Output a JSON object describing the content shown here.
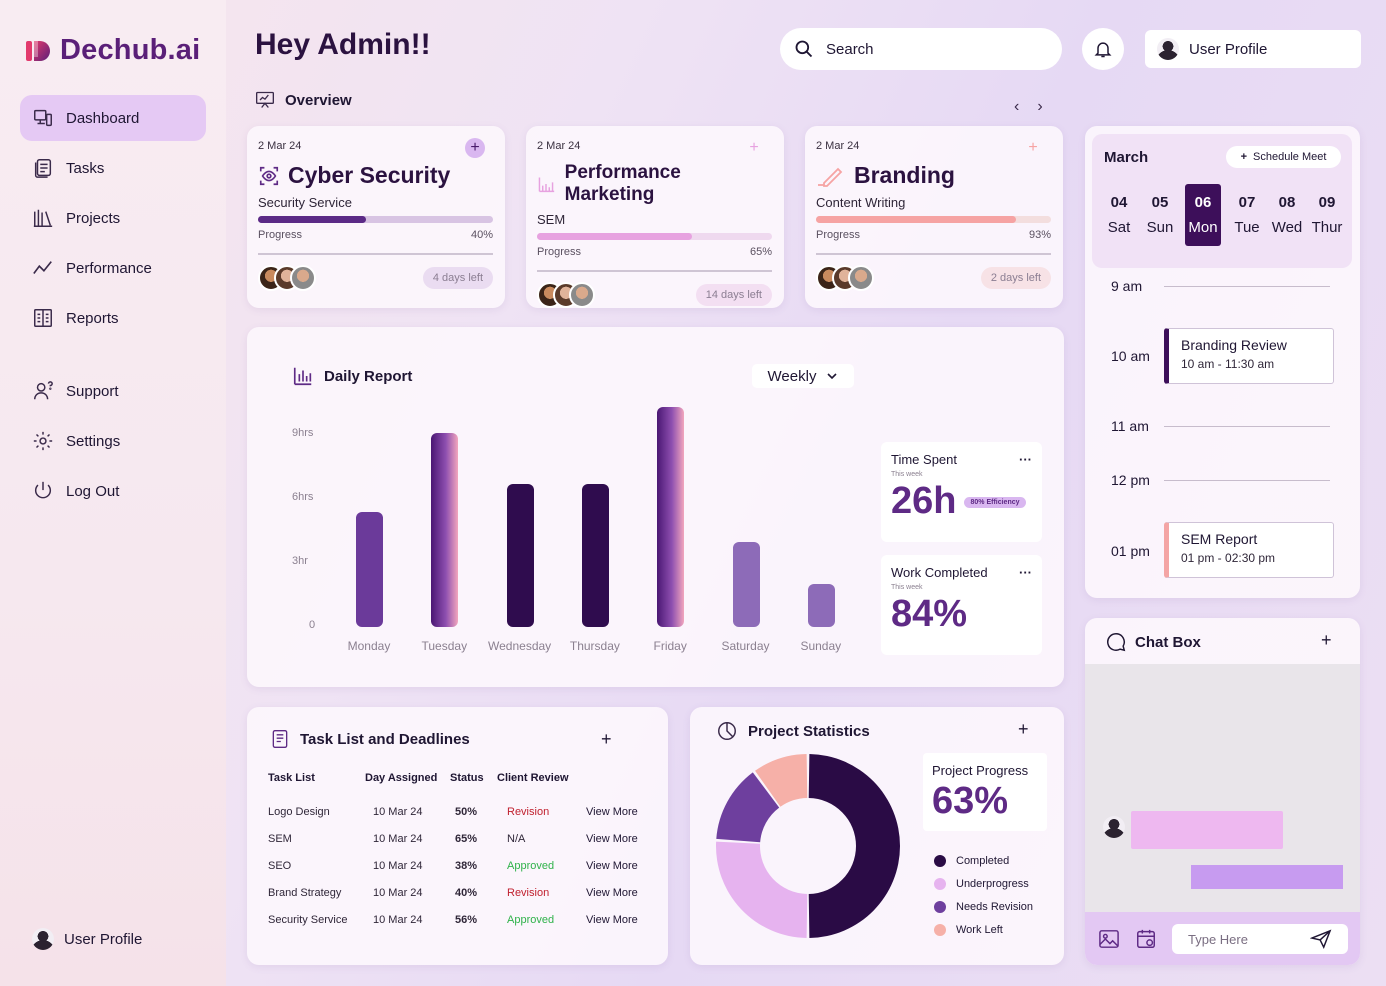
{
  "brand": {
    "name": "Dechub.ai"
  },
  "sidebar": {
    "items": [
      {
        "label": "Dashboard",
        "icon": "dashboard-icon",
        "active": true
      },
      {
        "label": "Tasks",
        "icon": "tasks-icon"
      },
      {
        "label": "Projects",
        "icon": "projects-icon"
      },
      {
        "label": "Performance",
        "icon": "performance-icon"
      },
      {
        "label": "Reports",
        "icon": "reports-icon"
      },
      {
        "label": "Support",
        "icon": "support-icon"
      },
      {
        "label": "Settings",
        "icon": "gear-icon"
      },
      {
        "label": "Log Out",
        "icon": "power-icon"
      }
    ],
    "profile_label": "User Profile"
  },
  "header": {
    "greeting": "Hey Admin!!",
    "search_label": "Search",
    "profile_label": "User Profile"
  },
  "overview": {
    "title": "Overview",
    "cards": [
      {
        "date": "2 Mar 24",
        "title": "Cyber Security",
        "subtitle": "Security Service",
        "progress_label": "Progress",
        "progress": "40%",
        "progress_value": 0.4,
        "days_left": "4 days left",
        "color": "#5b2a86",
        "track": "#d8c4e3",
        "plus_bg": "#d9b7f0",
        "plus_color": "#4a1a6b",
        "days_bg": "#eadcf1"
      },
      {
        "date": "2 Mar 24",
        "title": "Performance Marketing",
        "subtitle": "SEM",
        "progress_label": "Progress",
        "progress": "65%",
        "progress_value": 0.65,
        "days_left": "14 days left",
        "color": "#e7a2e0",
        "track": "#efd9ef",
        "plus_bg": "transparent",
        "plus_color": "#e7a2e0",
        "days_bg": "#f3dff2"
      },
      {
        "date": "2 Mar 24",
        "title": "Branding",
        "subtitle": "Content Writing",
        "progress_label": "Progress",
        "progress": "93%",
        "progress_value": 0.93,
        "days_left": "2 days left",
        "color": "#f6a3a3",
        "track": "#f3dede",
        "plus_bg": "transparent",
        "plus_color": "#f6a3a3",
        "days_bg": "#f7e2e6"
      }
    ]
  },
  "daily_report": {
    "title": "Daily Report",
    "period": "Weekly",
    "yticks": [
      "9hrs",
      "6hrs",
      "3hr",
      "0"
    ],
    "time_spent": {
      "title": "Time Spent",
      "period": "This week",
      "value": "26h",
      "badge": "80% Efficiency"
    },
    "work_completed": {
      "title": "Work Completed",
      "period": "This week",
      "value": "84%"
    }
  },
  "chart_data": {
    "type": "bar",
    "categories": [
      "Monday",
      "Tuesday",
      "Wednesday",
      "Thursday",
      "Friday",
      "Saturday",
      "Sunday"
    ],
    "values": [
      5.4,
      9.1,
      6.7,
      6.7,
      10.3,
      4.0,
      2.0
    ],
    "ylim": [
      0,
      10.5
    ],
    "yticks": [
      0,
      3,
      6,
      9
    ],
    "title": "Daily Report",
    "colors": [
      "#6b3a9a",
      "gradient-purple-pink",
      "#2f0c4e",
      "#2f0c4e",
      "gradient-purple-pink",
      "#8d6bb8",
      "#8d6bb8"
    ]
  },
  "task_list": {
    "title": "Task List and Deadlines",
    "columns": [
      "Task List",
      "Day Assigned",
      "Status",
      "Client Review"
    ],
    "rows": [
      {
        "task": "Logo Design",
        "day": "10 Mar 24",
        "status": "50%",
        "review": "Revision",
        "review_color": "#c0202e",
        "action": "View More"
      },
      {
        "task": "SEM",
        "day": "10 Mar 24",
        "status": "65%",
        "review": "N/A",
        "review_color": "#2f2638",
        "action": "View More"
      },
      {
        "task": "SEO",
        "day": "10 Mar 24",
        "status": "38%",
        "review": "Approved",
        "review_color": "#2fb24a",
        "action": "View More"
      },
      {
        "task": "Brand Strategy",
        "day": "10 Mar 24",
        "status": "40%",
        "review": "Revision",
        "review_color": "#c0202e",
        "action": "View More"
      },
      {
        "task": "Security Service",
        "day": "10 Mar 24",
        "status": "56%",
        "review": "Approved",
        "review_color": "#2fb24a",
        "action": "View More"
      }
    ]
  },
  "project_stats": {
    "title": "Project Statistics",
    "progress_label": "Project Progress",
    "progress_value": "63%",
    "legend": [
      {
        "label": "Completed",
        "color": "#2a0b45",
        "share": 0.5
      },
      {
        "label": "Underprogress",
        "color": "#e6b3ef",
        "share": 0.26
      },
      {
        "label": "Needs Revision",
        "color": "#6e3f9e",
        "share": 0.14
      },
      {
        "label": "Work Left",
        "color": "#f6b0a8",
        "share": 0.1
      }
    ]
  },
  "calendar": {
    "month": "March",
    "schedule_label": "Schedule Meet",
    "days": [
      {
        "num": "04",
        "name": "Sat"
      },
      {
        "num": "05",
        "name": "Sun"
      },
      {
        "num": "06",
        "name": "Mon",
        "selected": true
      },
      {
        "num": "07",
        "name": "Tue"
      },
      {
        "num": "08",
        "name": "Wed"
      },
      {
        "num": "09",
        "name": "Thur"
      }
    ],
    "times": [
      "9 am",
      "10 am",
      "11 am",
      "12 pm",
      "01 pm"
    ],
    "events": [
      {
        "title": "Branding Review",
        "time": "10 am - 11:30 am",
        "accent": "#3d0f5a"
      },
      {
        "title": "SEM Report",
        "time": "01 pm - 02:30 pm",
        "accent": "#f4a5a5"
      }
    ]
  },
  "chat": {
    "title": "Chat Box",
    "input_placeholder": "Type Here"
  }
}
